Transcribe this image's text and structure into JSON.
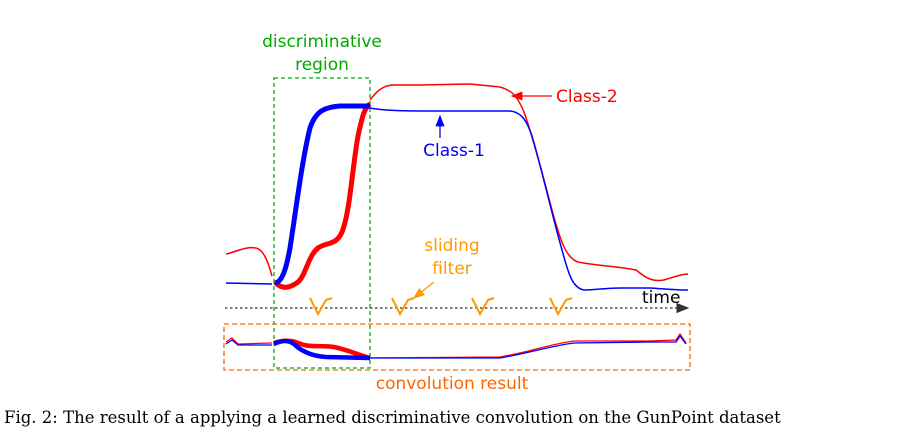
{
  "figure": {
    "labels": {
      "discriminative_line1": "discriminative",
      "discriminative_line2": "region",
      "class2": "Class-2",
      "class1": "Class-1",
      "sliding_line1": "sliding",
      "sliding_line2": "filter",
      "time": "time",
      "convolution": "convolution result"
    },
    "colors": {
      "class1": "#0000ff",
      "class2": "#ff0000",
      "region": "#00aa00",
      "filter": "#ff9900",
      "convolution": "#ff6600",
      "axis": "#333333"
    }
  },
  "caption": "Fig. 2: The result of a applying a learned discriminative convolution on the GunPoint dataset"
}
